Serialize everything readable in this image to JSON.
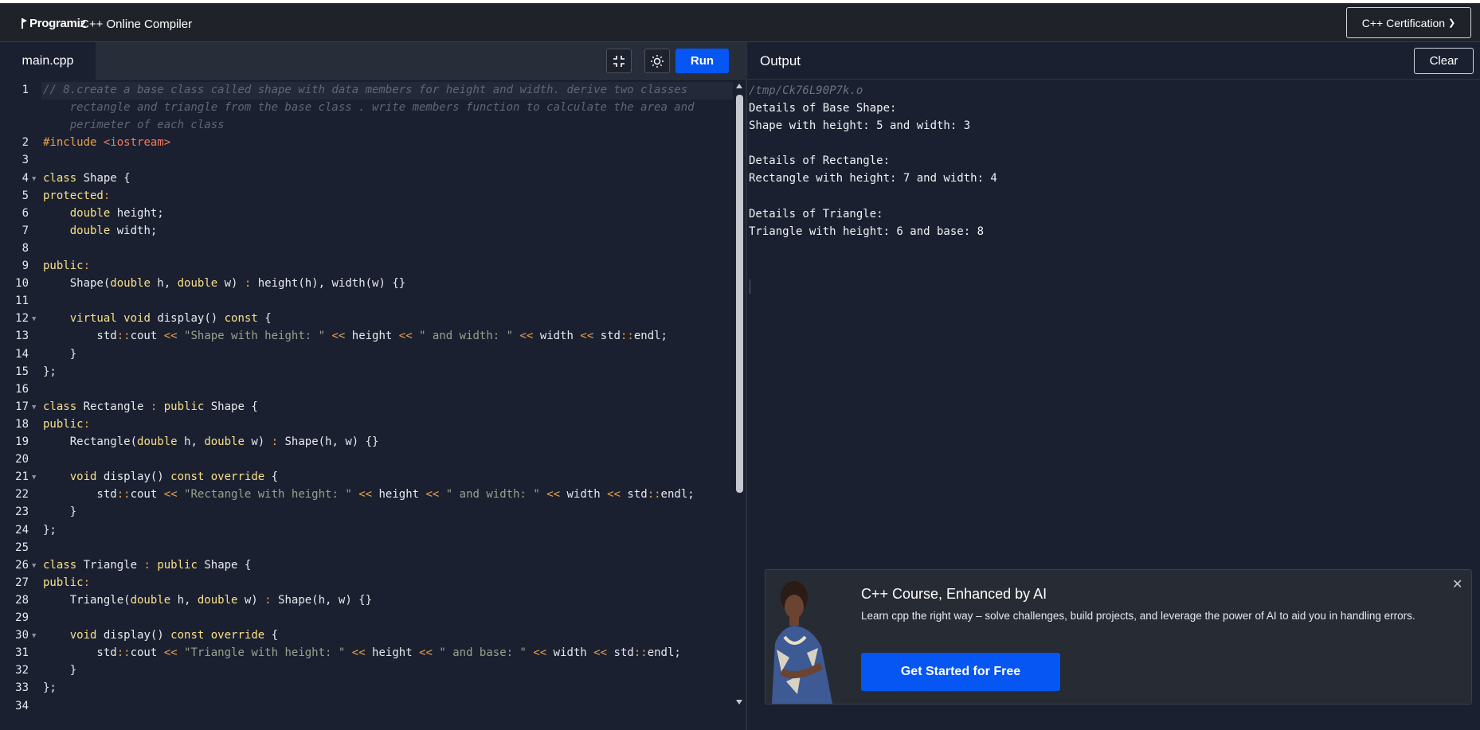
{
  "header": {
    "logo_text": "Programiz",
    "app_title": "C++ Online Compiler",
    "cert_label": "C++ Certification",
    "cert_arrow": "❯"
  },
  "editor": {
    "file_tab": "main.cpp",
    "run_label": "Run",
    "line_numbers": [
      "1",
      "2",
      "3",
      "4",
      "5",
      "6",
      "7",
      "8",
      "9",
      "10",
      "11",
      "12",
      "13",
      "14",
      "15",
      "16",
      "17",
      "18",
      "19",
      "20",
      "21",
      "22",
      "23",
      "24",
      "25",
      "26",
      "27",
      "28",
      "29",
      "30",
      "31",
      "32",
      "33",
      "34"
    ],
    "fold_markers": [
      "4",
      "12",
      "17",
      "21",
      "26",
      "30"
    ],
    "code_lines": [
      "// 8.create a base class called shape with data members for height and width. derive two classes",
      "    rectangle and triangle from the base class . write members function to calculate the area and",
      "    perimeter of each class",
      "#include <iostream>",
      "",
      "class Shape {",
      "protected:",
      "    double height;",
      "    double width;",
      "",
      "public:",
      "    Shape(double h, double w) : height(h), width(w) {}",
      "",
      "    virtual void display() const {",
      "        std::cout << \"Shape with height: \" << height << \" and width: \" << width << std::endl;",
      "    }",
      "};",
      "",
      "class Rectangle : public Shape {",
      "public:",
      "    Rectangle(double h, double w) : Shape(h, w) {}",
      "",
      "    void display() const override {",
      "        std::cout << \"Rectangle with height: \" << height << \" and width: \" << width << std::endl;",
      "    }",
      "};",
      "",
      "class Triangle : public Shape {",
      "public:",
      "    Triangle(double h, double w) : Shape(h, w) {}",
      "",
      "    void display() const override {",
      "        std::cout << \"Triangle with height: \" << height << \" and base: \" << width << std::endl;",
      "    }",
      "};",
      ""
    ]
  },
  "output": {
    "title": "Output",
    "clear_label": "Clear",
    "path": "/tmp/Ck76L90P7k.o",
    "lines": [
      "Details of Base Shape:",
      "Shape with height: 5 and width: 3",
      "",
      "Details of Rectangle:",
      "Rectangle with height: 7 and width: 4",
      "",
      "Details of Triangle:",
      "Triangle with height: 6 and base: 8"
    ]
  },
  "promo": {
    "title": "C++ Course, Enhanced by AI",
    "description": "Learn cpp the right way – solve challenges, build projects, and leverage the power of AI to aid you in handling errors.",
    "cta": "Get Started for Free",
    "close": "✕"
  },
  "colors": {
    "accent": "#0556f3",
    "background": "#1b2030",
    "topbar": "#1f2229",
    "keyword": "#f8e087",
    "string": "#9aa18a",
    "operator": "#e7a24a",
    "include": "#f07a5e",
    "comment": "#5f6676"
  },
  "icons": {
    "collapse": "collapse-icon",
    "theme": "sun-icon",
    "close": "close-icon",
    "chevron": "chevron-right-icon"
  }
}
